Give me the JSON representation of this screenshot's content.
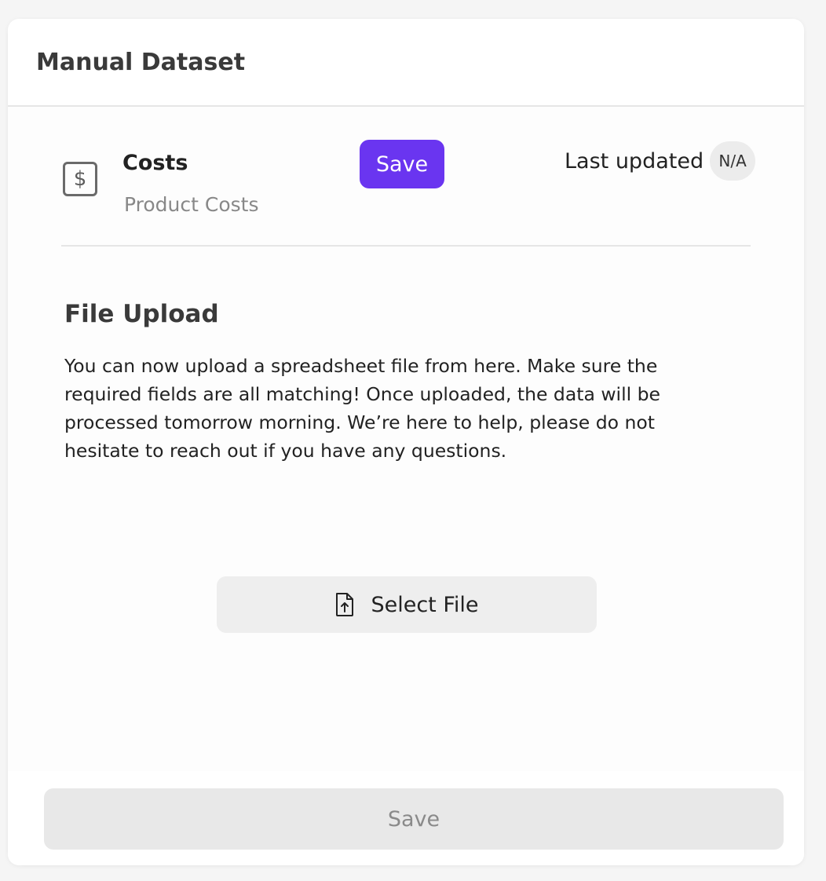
{
  "card": {
    "title": "Manual Dataset"
  },
  "dataset": {
    "icon": "dollar-icon",
    "name": "Costs",
    "subtitle": "Product Costs",
    "save_label": "Save",
    "last_updated_label": "Last updated",
    "last_updated_value": "N/A"
  },
  "upload": {
    "title": "File Upload",
    "description": "You can now upload a spreadsheet file from here. Make sure the required fields are all matching! Once uploaded, the data will be processed tomorrow morning. We’re here to help, please do not hesitate to reach out if you have any questions.",
    "select_file_label": "Select File",
    "select_file_icon": "file-upload-icon"
  },
  "footer": {
    "save_label": "Save"
  },
  "colors": {
    "accent": "#6a35f0",
    "disabled_button": "#e8e8e8",
    "badge_bg": "#ececec"
  }
}
